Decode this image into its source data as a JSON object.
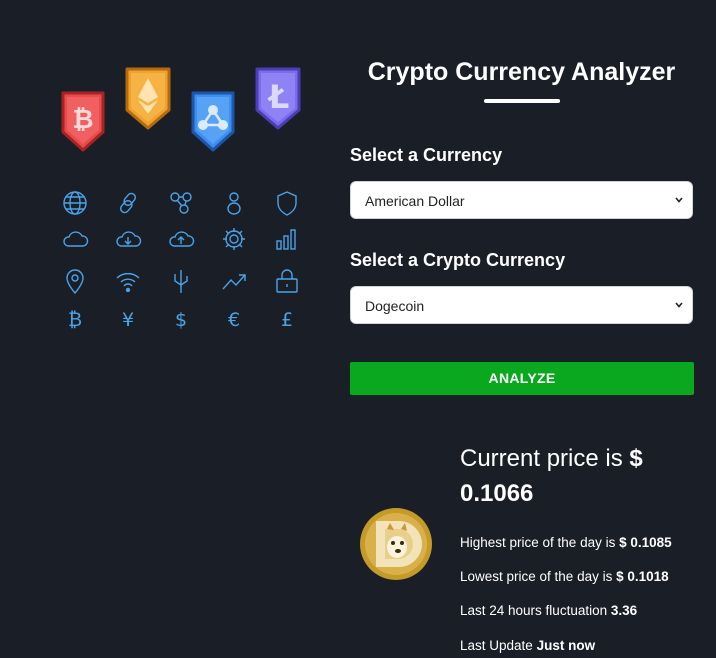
{
  "app": {
    "title": "Crypto Currency Analyzer"
  },
  "illustration": {
    "badges": [
      {
        "name": "bitcoin",
        "icon": "bitcoin-icon",
        "color": "#e94b4b"
      },
      {
        "name": "ethereum",
        "icon": "ethereum-icon",
        "color": "#f0a12e"
      },
      {
        "name": "ripple",
        "icon": "ripple-icon",
        "color": "#3d8ef0"
      },
      {
        "name": "litecoin",
        "icon": "litecoin-icon",
        "color": "#7a6cf0"
      }
    ],
    "grid_icons": [
      "globe-icon",
      "link-icon",
      "network-icon",
      "user-icon",
      "shield-icon",
      "cloud-icon",
      "cloud-download-icon",
      "cloud-upload-icon",
      "gear-icon",
      "bar-chart-icon",
      "location-pin-icon",
      "wifi-icon",
      "usb-icon",
      "trend-up-icon",
      "lock-icon",
      "bitcoin-symbol-icon",
      "yen-symbol-icon",
      "dollar-symbol-icon",
      "euro-symbol-icon",
      "pound-symbol-icon"
    ],
    "icon_color": "#4aa3e8"
  },
  "form": {
    "currency_label": "Select a Currency",
    "currency_value": "American Dollar",
    "crypto_label": "Select a Crypto Currency",
    "crypto_value": "Dogecoin",
    "analyze_label": "ANALYZE"
  },
  "result": {
    "coin_icon": "dogecoin-icon",
    "current_price_label": "Current price is",
    "current_price_value": "$ 0.1066",
    "highest_label": "Highest price of the day is",
    "highest_value": "$ 0.1085",
    "lowest_label": "Lowest price of the day is",
    "lowest_value": "$ 0.1018",
    "fluctuation_label": "Last 24 hours fluctuation",
    "fluctuation_value": "3.36",
    "last_update_label": "Last Update",
    "last_update_value": "Just now"
  },
  "colors": {
    "background": "#1a1e27",
    "accent_button": "#0aa81f",
    "text": "#ffffff"
  }
}
